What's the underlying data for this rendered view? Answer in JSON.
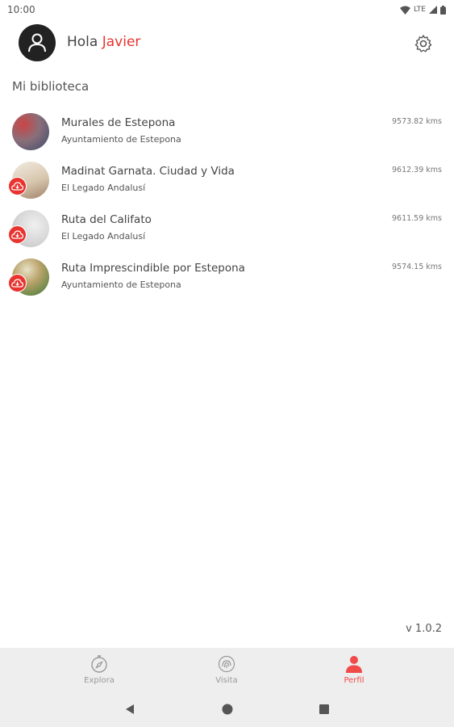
{
  "status_bar": {
    "time": "10:00",
    "network": "LTE"
  },
  "header": {
    "greeting": "Hola",
    "user_name": "Javier"
  },
  "section_title": "Mi biblioteca",
  "items": [
    {
      "title": "Murales de Estepona",
      "subtitle": "Ayuntamiento de Estepona",
      "distance": "9573.82 kms",
      "thumb_color": "#7a5a6a",
      "download_badge": false
    },
    {
      "title": "Madinat Garnata. Ciudad y Vida",
      "subtitle": "El Legado Andalusí",
      "distance": "9612.39 kms",
      "thumb_color": "#d9cbb8",
      "download_badge": true
    },
    {
      "title": "Ruta del Califato",
      "subtitle": "El Legado Andalusí",
      "distance": "9611.59 kms",
      "thumb_color": "#d8d8d8",
      "download_badge": true
    },
    {
      "title": "Ruta Imprescindible por Estepona",
      "subtitle": "Ayuntamiento de Estepona",
      "distance": "9574.15 kms",
      "thumb_color": "#8a9a5a",
      "download_badge": true
    }
  ],
  "version": "v 1.0.2",
  "bottom_nav": [
    {
      "label": "Explora",
      "icon": "compass-icon",
      "active": false
    },
    {
      "label": "Visita",
      "icon": "fingerprint-icon",
      "active": false
    },
    {
      "label": "Perfil",
      "icon": "person-icon",
      "active": true
    }
  ],
  "colors": {
    "accent": "#e8332f",
    "nav_bg": "#eeeeee",
    "inactive": "#999999"
  }
}
